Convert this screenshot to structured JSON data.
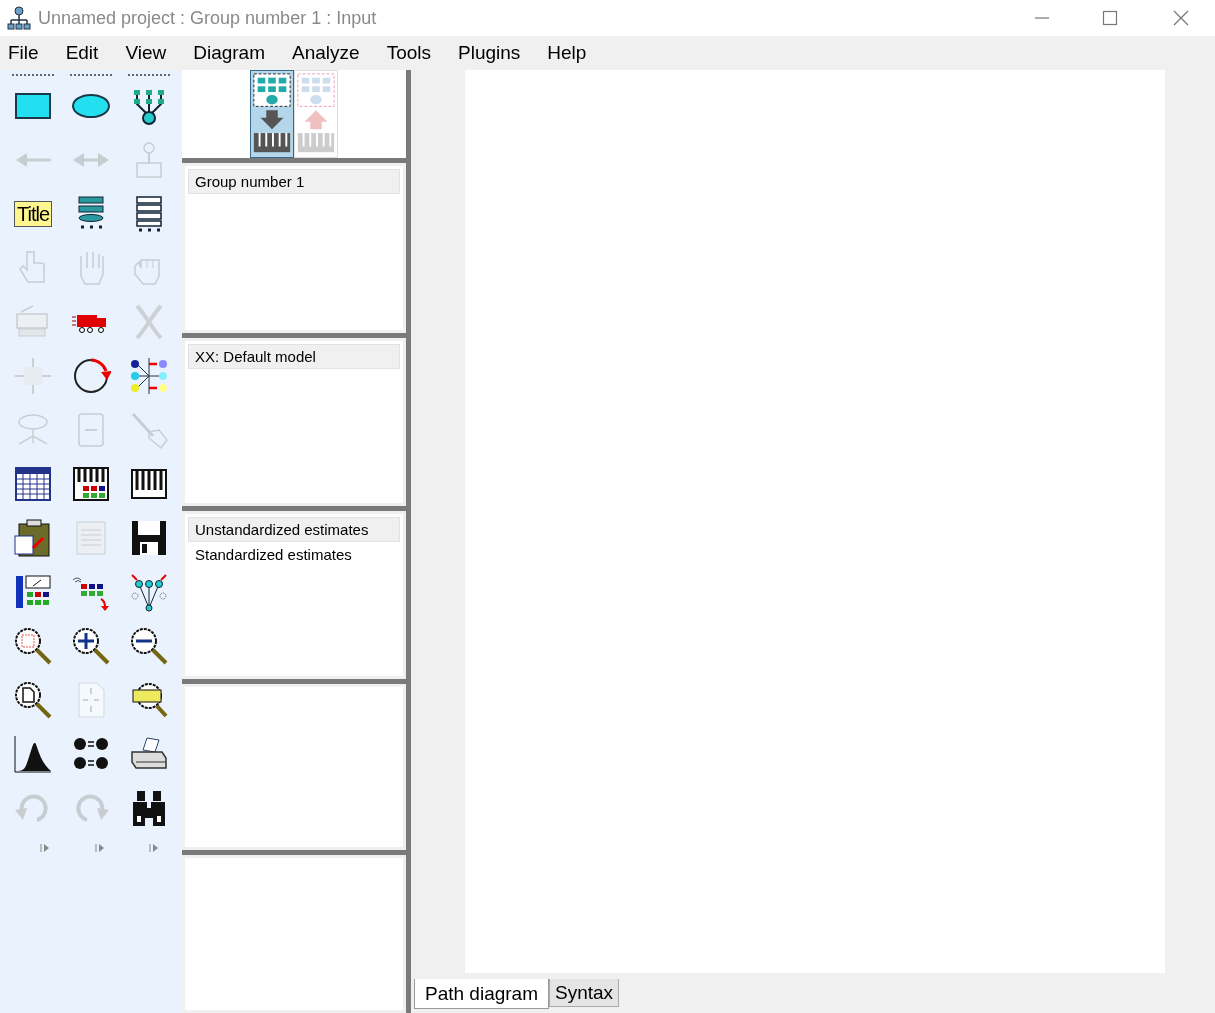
{
  "window": {
    "title": "Unnamed project : Group number 1 : Input"
  },
  "menu": [
    "File",
    "Edit",
    "View",
    "Diagram",
    "Analyze",
    "Tools",
    "Plugins",
    "Help"
  ],
  "toolbox": [
    {
      "kind": "rectangle",
      "disabled": false
    },
    {
      "kind": "ellipse",
      "disabled": false
    },
    {
      "kind": "indicator",
      "disabled": false
    },
    {
      "kind": "arrow",
      "disabled": true
    },
    {
      "kind": "double-arrow",
      "disabled": true
    },
    {
      "kind": "unique",
      "disabled": true
    },
    {
      "kind": "title",
      "label": "Title",
      "disabled": false
    },
    {
      "kind": "list",
      "disabled": false
    },
    {
      "kind": "list-dark",
      "disabled": false
    },
    {
      "kind": "point-hand",
      "disabled": true
    },
    {
      "kind": "open-hand",
      "disabled": true
    },
    {
      "kind": "fist",
      "disabled": true
    },
    {
      "kind": "copier",
      "disabled": true
    },
    {
      "kind": "truck",
      "disabled": false
    },
    {
      "kind": "cross",
      "disabled": true
    },
    {
      "kind": "resize",
      "disabled": true
    },
    {
      "kind": "rotate",
      "disabled": false
    },
    {
      "kind": "reflect",
      "disabled": false
    },
    {
      "kind": "oval-arrows",
      "disabled": true
    },
    {
      "kind": "scroll",
      "disabled": true
    },
    {
      "kind": "wand",
      "disabled": true
    },
    {
      "kind": "table",
      "disabled": false
    },
    {
      "kind": "keys-grid",
      "disabled": false
    },
    {
      "kind": "keys",
      "disabled": false
    },
    {
      "kind": "clipboard",
      "disabled": false
    },
    {
      "kind": "text-view",
      "disabled": true
    },
    {
      "kind": "floppy",
      "disabled": false
    },
    {
      "kind": "meter",
      "disabled": false
    },
    {
      "kind": "drag",
      "disabled": false
    },
    {
      "kind": "symmetry",
      "disabled": false
    },
    {
      "kind": "zoom-area",
      "disabled": false
    },
    {
      "kind": "zoom-in",
      "disabled": false
    },
    {
      "kind": "zoom-out",
      "disabled": false
    },
    {
      "kind": "zoom-page",
      "disabled": false
    },
    {
      "kind": "fit-page",
      "disabled": true
    },
    {
      "kind": "loupe",
      "disabled": false
    },
    {
      "kind": "distribution",
      "disabled": false
    },
    {
      "kind": "faces",
      "disabled": false
    },
    {
      "kind": "printer",
      "disabled": false
    },
    {
      "kind": "undo",
      "disabled": true
    },
    {
      "kind": "redo",
      "disabled": true
    },
    {
      "kind": "binoculars",
      "disabled": false
    }
  ],
  "view_modes": [
    {
      "kind": "input",
      "selected": true,
      "disabled": false
    },
    {
      "kind": "output",
      "selected": false,
      "disabled": true
    }
  ],
  "groups": [
    {
      "label": "Group number 1",
      "selected": true
    }
  ],
  "models": [
    {
      "label": "XX: Default model",
      "selected": true
    }
  ],
  "estimates": [
    {
      "label": "Unstandardized estimates",
      "selected": true
    },
    {
      "label": "Standardized estimates",
      "selected": false
    }
  ],
  "tabs": [
    {
      "label": "Path diagram",
      "selected": true
    },
    {
      "label": "Syntax",
      "selected": false
    }
  ]
}
